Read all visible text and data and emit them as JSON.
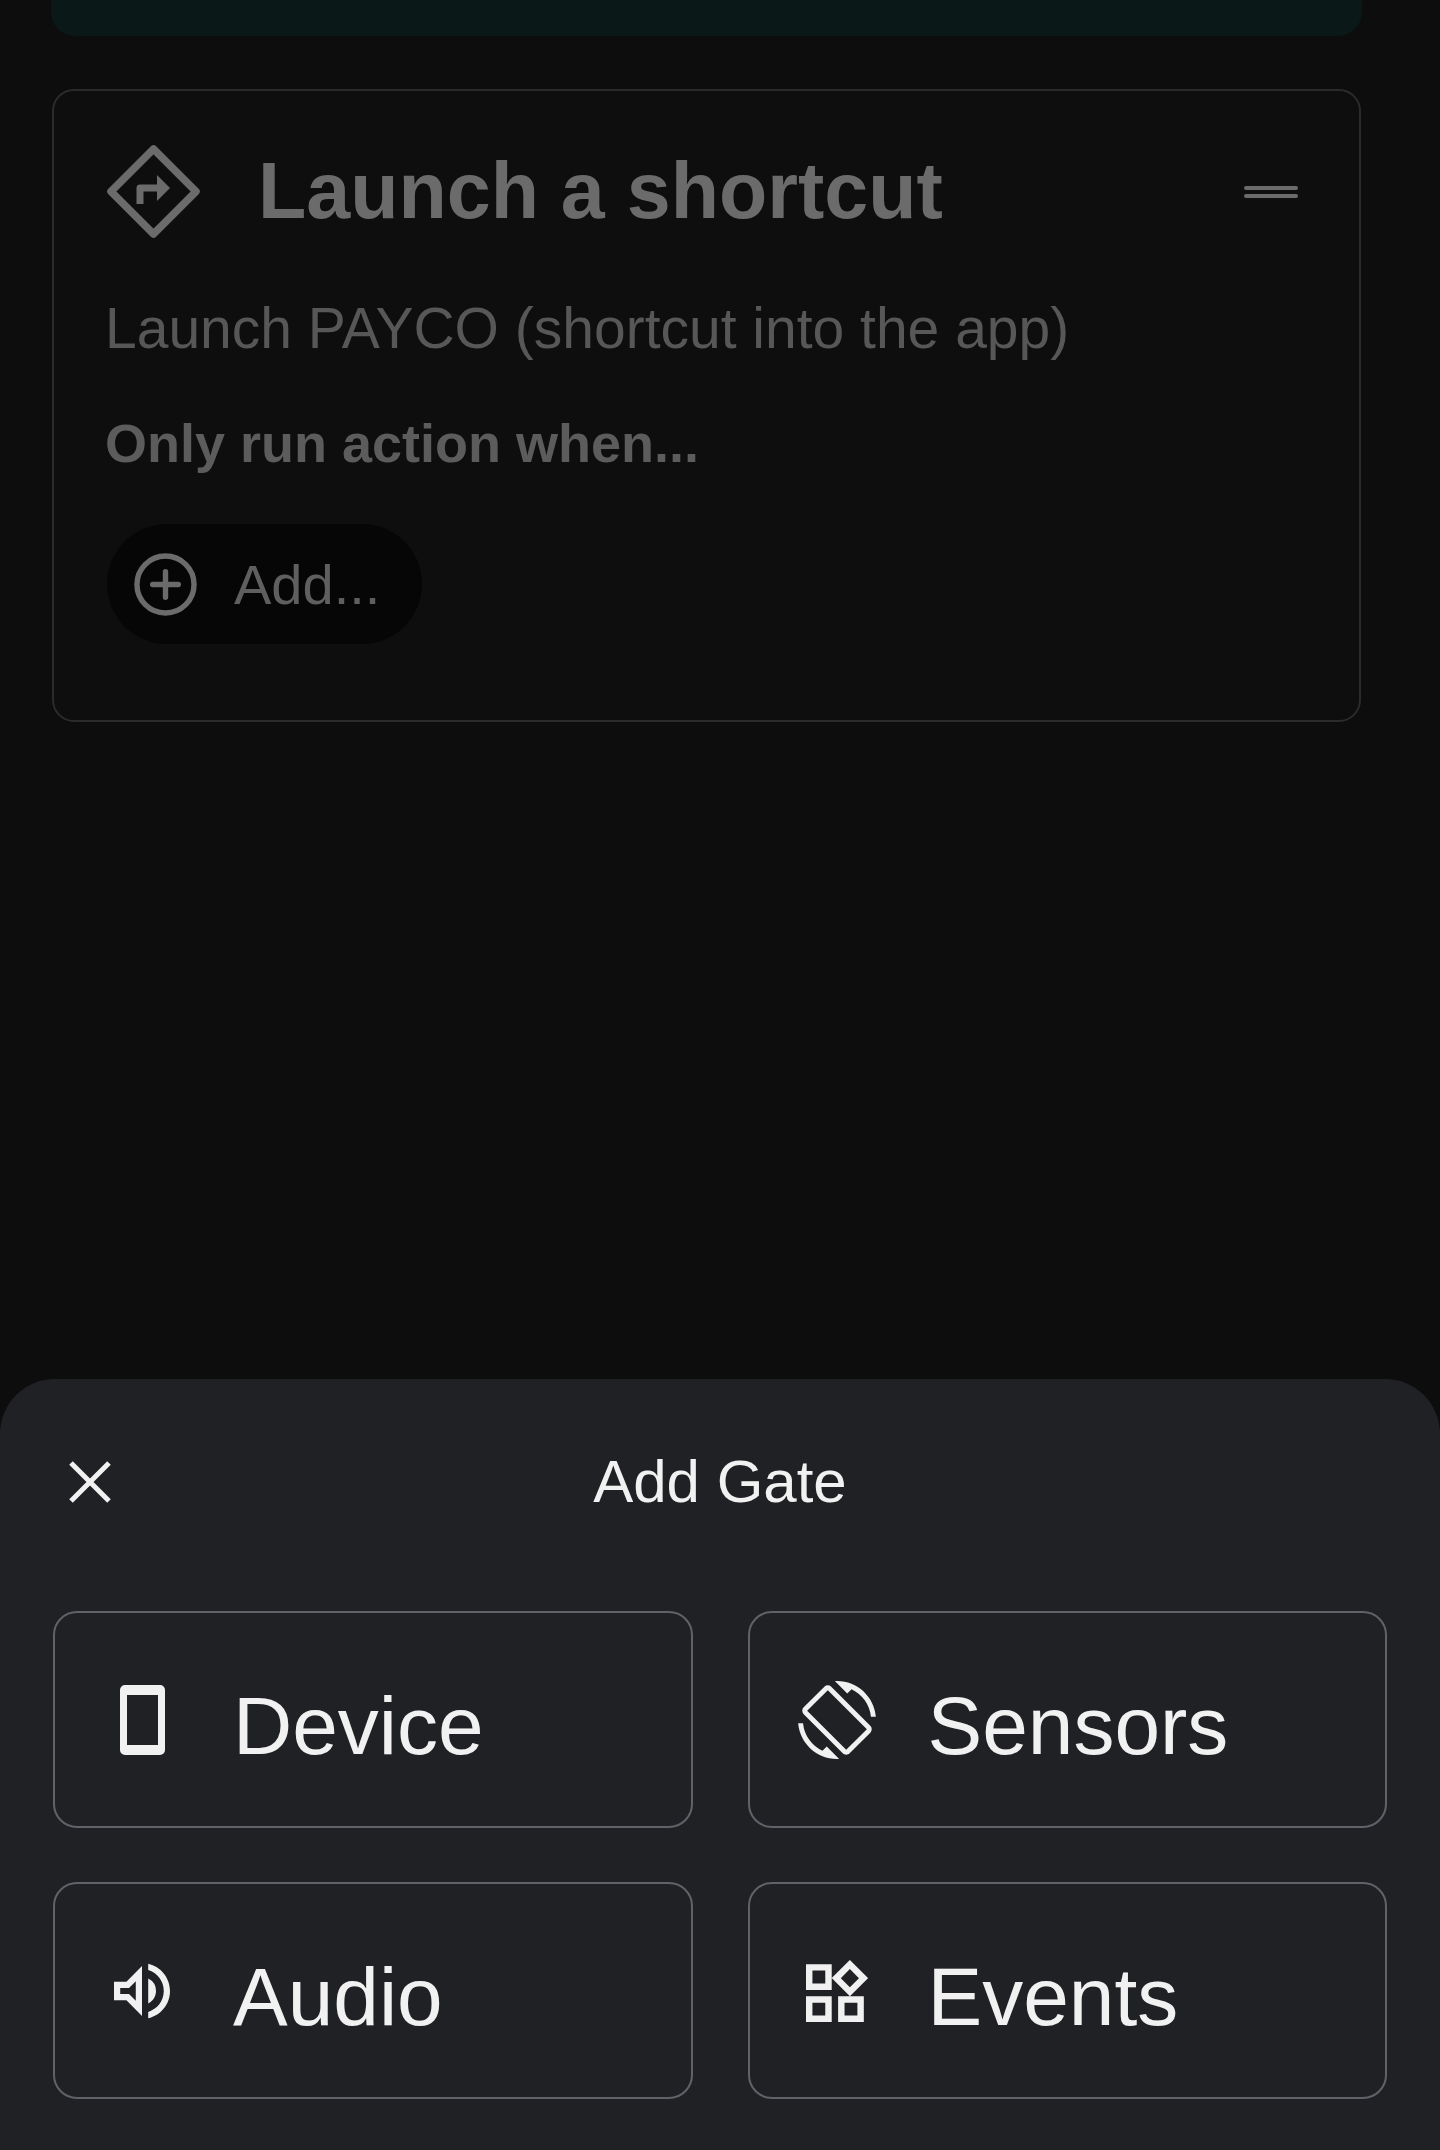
{
  "action_card": {
    "title": "Launch a shortcut",
    "description": "Launch PAYCO (shortcut into the app)",
    "condition_heading": "Only run action when...",
    "add_button": "Add..."
  },
  "sheet": {
    "title": "Add Gate",
    "options": [
      {
        "label": "Device",
        "kind": "device"
      },
      {
        "label": "Sensors",
        "kind": "sensors"
      },
      {
        "label": "Audio",
        "kind": "audio"
      },
      {
        "label": "Events",
        "kind": "events"
      }
    ]
  }
}
